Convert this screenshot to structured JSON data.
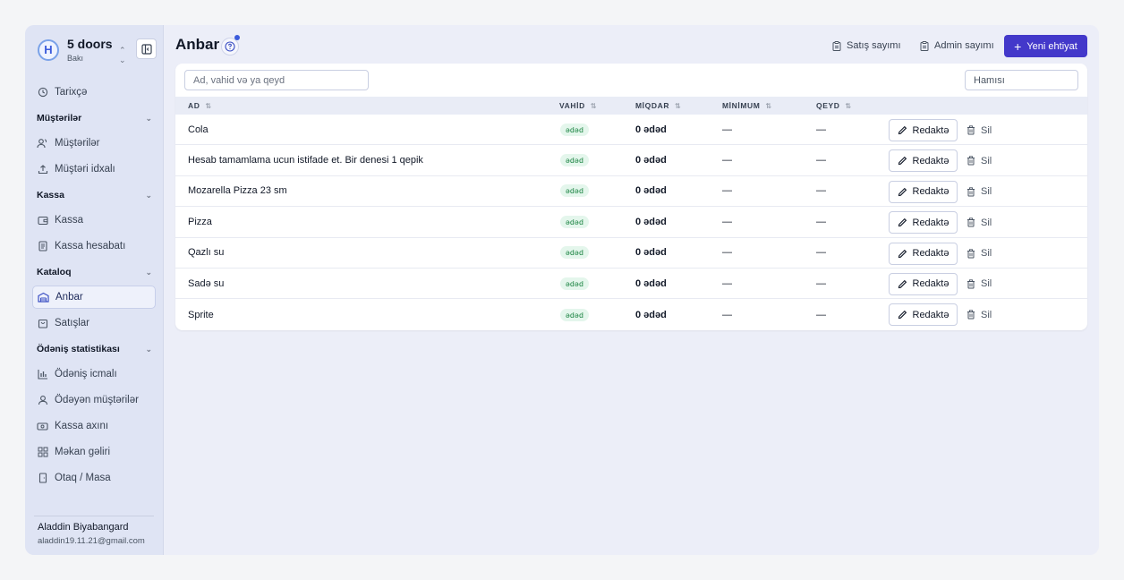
{
  "brand": {
    "name": "5 doors",
    "city": "Bakı",
    "logo_text": "H"
  },
  "sidebar": {
    "items": [
      {
        "type": "item",
        "label": "Tarixçə",
        "icon": "history-icon",
        "active": false
      },
      {
        "type": "group",
        "label": "Müştərilər"
      },
      {
        "type": "item",
        "label": "Müştərilər",
        "icon": "users-icon",
        "active": false
      },
      {
        "type": "item",
        "label": "Müştəri idxalı",
        "icon": "upload-icon",
        "active": false
      },
      {
        "type": "group",
        "label": "Kassa"
      },
      {
        "type": "item",
        "label": "Kassa",
        "icon": "wallet-icon",
        "active": false
      },
      {
        "type": "item",
        "label": "Kassa hesabatı",
        "icon": "report-icon",
        "active": false
      },
      {
        "type": "group",
        "label": "Kataloq"
      },
      {
        "type": "item",
        "label": "Anbar",
        "icon": "warehouse-icon",
        "active": true
      },
      {
        "type": "item",
        "label": "Satışlar",
        "icon": "shopping-bag-icon",
        "active": false
      },
      {
        "type": "group",
        "label": "Ödəniş statistikası"
      },
      {
        "type": "item",
        "label": "Ödəniş icmalı",
        "icon": "bar-chart-icon",
        "active": false
      },
      {
        "type": "item",
        "label": "Ödəyən müştərilər",
        "icon": "user-icon",
        "active": false
      },
      {
        "type": "item",
        "label": "Kassa axını",
        "icon": "cash-icon",
        "active": false
      },
      {
        "type": "item",
        "label": "Məkan gəliri",
        "icon": "grid-icon",
        "active": false
      },
      {
        "type": "item",
        "label": "Otaq / Masa",
        "icon": "door-icon",
        "active": false
      }
    ]
  },
  "user": {
    "name": "Aladdin Biyabangard",
    "email": "aladdin19.11.21@gmail.com"
  },
  "header": {
    "title": "Anbar",
    "sales_count_label": "Satış sayımı",
    "admin_count_label": "Admin sayımı",
    "new_stock_label": "Yeni ehtiyat"
  },
  "search": {
    "placeholder": "Ad, vahid və ya qeyd",
    "value": ""
  },
  "filter": {
    "value": "Hamısı"
  },
  "table": {
    "columns": [
      "AD",
      "VAHİD",
      "MİQDAR",
      "MİNİMUM",
      "QEYD"
    ],
    "rows": [
      {
        "name": "Cola",
        "unit": "ədəd",
        "quantity": "0 ədəd",
        "minimum": "—",
        "note": "—"
      },
      {
        "name": "Hesab tamamlama ucun istifade et. Bir denesi 1 qepik",
        "unit": "ədəd",
        "quantity": "0 ədəd",
        "minimum": "—",
        "note": "—"
      },
      {
        "name": "Mozarella Pizza 23 sm",
        "unit": "ədəd",
        "quantity": "0 ədəd",
        "minimum": "—",
        "note": "—"
      },
      {
        "name": "Pizza",
        "unit": "ədəd",
        "quantity": "0 ədəd",
        "minimum": "—",
        "note": "—"
      },
      {
        "name": "Qazlı su",
        "unit": "ədəd",
        "quantity": "0 ədəd",
        "minimum": "—",
        "note": "—"
      },
      {
        "name": "Sadə su",
        "unit": "ədəd",
        "quantity": "0 ədəd",
        "minimum": "—",
        "note": "—"
      },
      {
        "name": "Sprite",
        "unit": "ədəd",
        "quantity": "0 ədəd",
        "minimum": "—",
        "note": "—"
      }
    ],
    "edit_label": "Redaktə",
    "delete_label": "Sil"
  },
  "colors": {
    "primary": "#4338ca",
    "badge_bg": "#e4f6ec",
    "badge_text": "#15803d",
    "sidebar_bg": "#dfe4f4"
  }
}
